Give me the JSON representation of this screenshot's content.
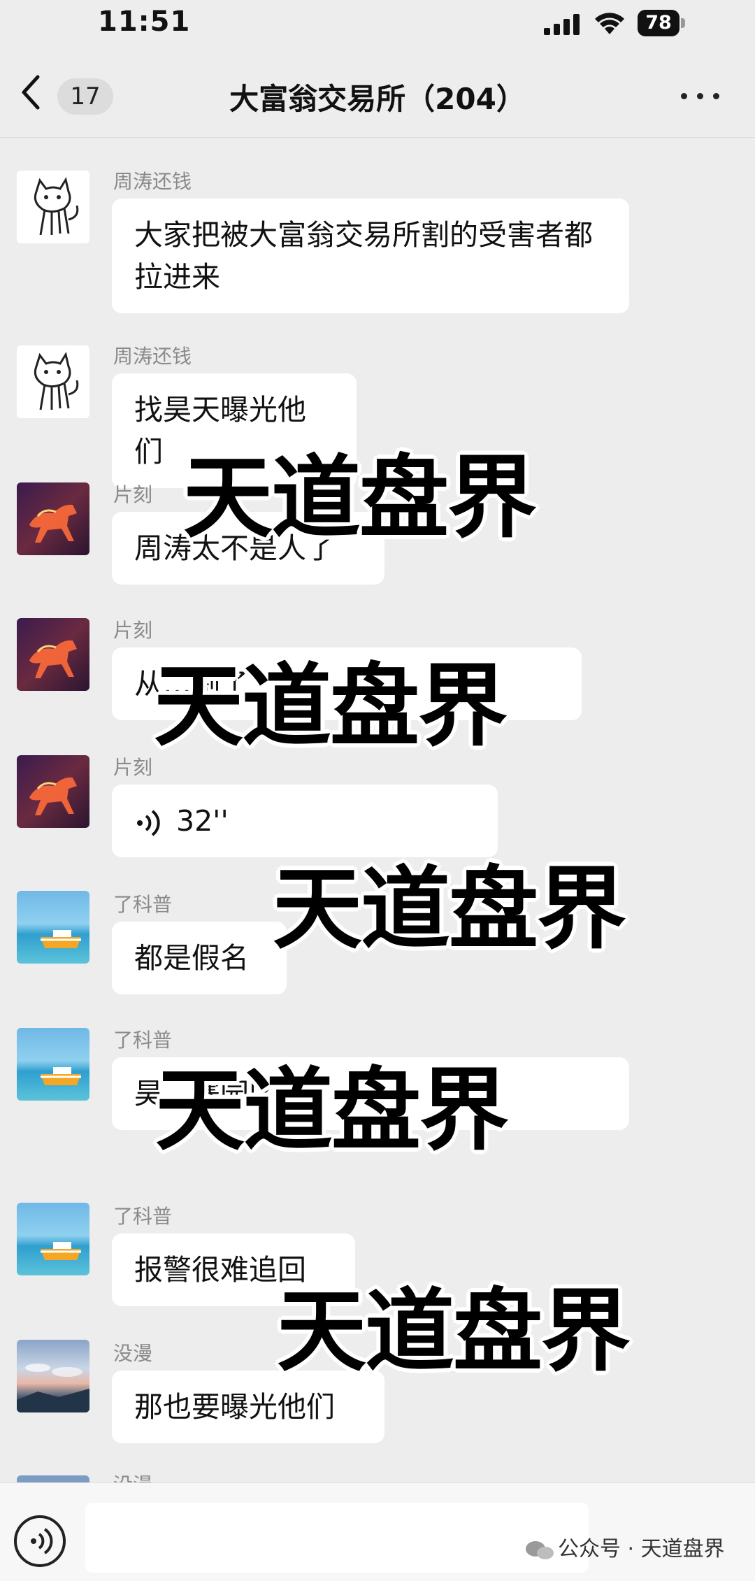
{
  "status_bar": {
    "time": "11:51",
    "battery": "78"
  },
  "header": {
    "unread_count": "17",
    "title": "大富翁交易所（204）"
  },
  "messages": [
    {
      "sender": "周涛还钱",
      "avatar": "cat-drawing",
      "text": "大家把被大富翁交易所割的受害者都拉进来"
    },
    {
      "sender": "周涛还钱",
      "avatar": "cat-drawing",
      "text": "找昊天曝光他们"
    },
    {
      "sender": "片刻",
      "avatar": "fire-horse",
      "text": "周涛太不是人了"
    },
    {
      "sender": "片刻",
      "avatar": "fire-horse",
      "text": "从…割了"
    },
    {
      "sender": "片刻",
      "avatar": "fire-horse",
      "text": "32''",
      "type": "voice"
    },
    {
      "sender": "了科普",
      "avatar": "boat-sea",
      "text": "都是假名"
    },
    {
      "sender": "了科普",
      "avatar": "boat-sea",
      "text": "昊…寨园区里"
    },
    {
      "sender": "了科普",
      "avatar": "boat-sea",
      "text": "报警很难追回"
    },
    {
      "sender": "没漫",
      "avatar": "sky-clouds",
      "text": "那也要曝光他们"
    },
    {
      "sender": "没漫",
      "avatar": "sky-clouds",
      "text": ""
    }
  ],
  "watermark": {
    "text": "天道盘界",
    "footer": "公众号 · 天道盘界"
  },
  "colors": {
    "background": "#ededed",
    "bubble": "#ffffff",
    "sender": "#8a8a8a"
  }
}
